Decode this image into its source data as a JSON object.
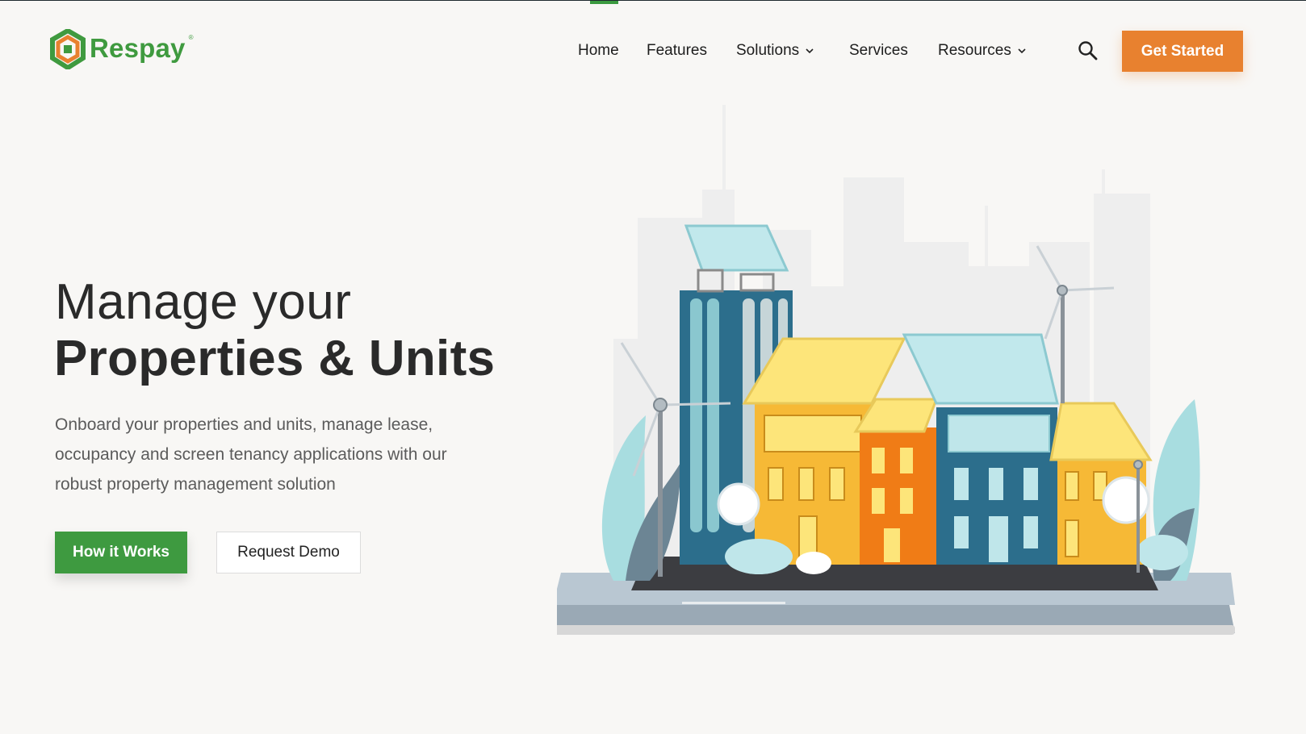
{
  "brand": {
    "name": "Respay",
    "reg": "®",
    "green": "#3f9a3f",
    "orange": "#e8812f",
    "teal": "#2c6e8c"
  },
  "nav": {
    "items": [
      {
        "label": "Home"
      },
      {
        "label": "Features"
      },
      {
        "label": "Solutions",
        "icon": "chevron-down-icon"
      },
      {
        "label": "Services"
      },
      {
        "label": "Resources",
        "icon": "chevron-down-icon"
      }
    ],
    "search_icon": "search-icon",
    "cta_label": "Get Started"
  },
  "hero": {
    "title_light": "Manage your",
    "title_bold": "Properties & Units",
    "description": "Onboard your properties and units, manage lease, occupancy and screen tenancy applications with our robust property management solution",
    "primary_button": "How it Works",
    "secondary_button": "Request Demo"
  }
}
